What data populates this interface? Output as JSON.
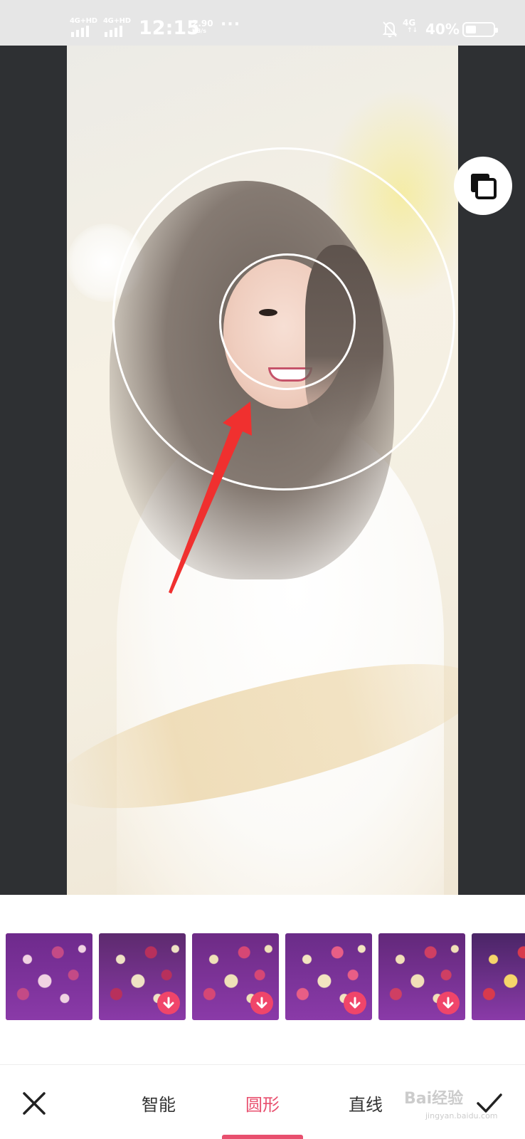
{
  "status_bar": {
    "sim1_label": "4G+HD",
    "sim2_label": "4G+HD",
    "time": "12:15",
    "speed_value": "2.90",
    "speed_unit": "KB/s",
    "more_dots": "···",
    "data_label": "4G",
    "data_sub": "↑↓",
    "battery_percent": "40%",
    "battery_level": 0.4,
    "icons": [
      "signal-icon",
      "signal-icon",
      "mute-bell-icon",
      "battery-icon"
    ]
  },
  "editor": {
    "photo_description_icon": "portrait-photo",
    "compare_icon": "compare-layers-icon",
    "overlay_shapes": [
      "outer-focus-ring",
      "inner-focus-ring",
      "red-annotation-arrow"
    ],
    "colors": {
      "background": "#2e3033",
      "ring": "#ffffff",
      "arrow": "#f0302f"
    }
  },
  "effects": [
    {
      "name": "bokeh-1",
      "selected": true,
      "downloadable": false,
      "colors": [
        "#6e2a8c",
        "#c44a86",
        "#f0d2e2"
      ]
    },
    {
      "name": "bokeh-2",
      "selected": false,
      "downloadable": true,
      "colors": [
        "#5d2a6e",
        "#b8305c",
        "#efe2c4"
      ]
    },
    {
      "name": "bokeh-3",
      "selected": false,
      "downloadable": true,
      "colors": [
        "#6d2b85",
        "#d64775",
        "#efe1b8"
      ]
    },
    {
      "name": "bokeh-hearts",
      "selected": false,
      "downloadable": true,
      "colors": [
        "#6a2c88",
        "#e85e86",
        "#f3e4c0"
      ]
    },
    {
      "name": "bokeh-hexagons",
      "selected": false,
      "downloadable": true,
      "colors": [
        "#62287a",
        "#cf3f63",
        "#f1dfb8"
      ]
    },
    {
      "name": "bokeh-stars",
      "selected": false,
      "downloadable": false,
      "colors": [
        "#4a2566",
        "#d83a4d",
        "#f6d56a"
      ]
    }
  ],
  "bottom_bar": {
    "close_icon": "close-icon",
    "modes": [
      "智能",
      "圆形",
      "直线"
    ],
    "active_mode": "圆形",
    "confirm_icon": "check-icon",
    "accent": "#e84f6e"
  },
  "watermark": {
    "text": "Bai经验",
    "sub": "jingyan.baidu.com"
  }
}
